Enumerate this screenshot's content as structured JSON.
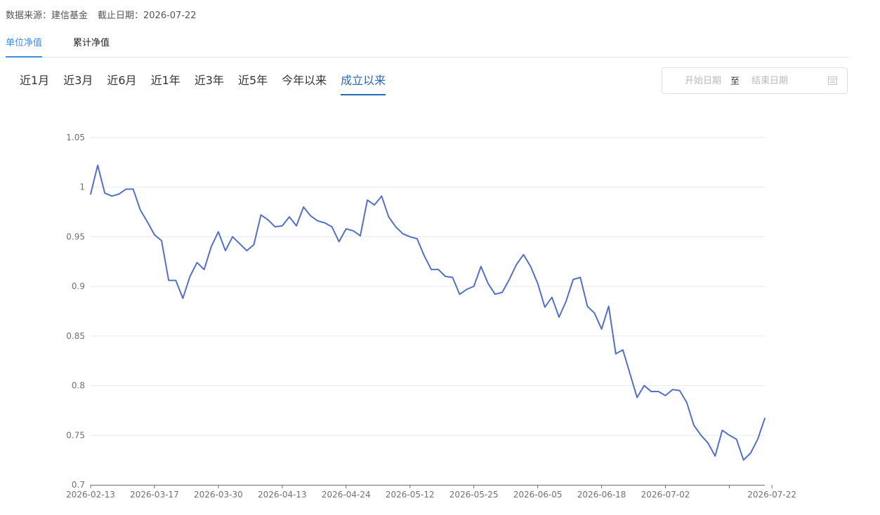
{
  "header": {
    "source_label": "数据来源：建信基金",
    "date_label": "截止日期：2026-07-22"
  },
  "tabs": [
    {
      "label": "单位净值",
      "active": true
    },
    {
      "label": "累计净值",
      "active": false
    }
  ],
  "ranges": [
    {
      "label": "近1月",
      "active": false
    },
    {
      "label": "近3月",
      "active": false
    },
    {
      "label": "近6月",
      "active": false
    },
    {
      "label": "近1年",
      "active": false
    },
    {
      "label": "近3年",
      "active": false
    },
    {
      "label": "近5年",
      "active": false
    },
    {
      "label": "今年以来",
      "active": false
    },
    {
      "label": "成立以来",
      "active": true
    }
  ],
  "date_picker": {
    "start_placeholder": "开始日期",
    "separator": "至",
    "end_placeholder": "结束日期",
    "icon": "calendar-icon"
  },
  "colors": {
    "accent_tab": "#3e8ee0",
    "accent_range": "#2868b8",
    "line": "#5470c6",
    "grid": "#e6e9ef",
    "axis": "#6e7079"
  },
  "chart_data": {
    "type": "line",
    "title": "",
    "xlabel": "",
    "ylabel": "",
    "ylim": [
      0.7,
      1.05
    ],
    "yticks": [
      "0.7",
      "0.75",
      "0.8",
      "0.85",
      "0.9",
      "0.95",
      "1",
      "1.05"
    ],
    "xtick_labels": [
      {
        "index": 0,
        "label": "2026-02-13"
      },
      {
        "index": 9,
        "label": "2026-03-17"
      },
      {
        "index": 18,
        "label": "2026-03-30"
      },
      {
        "index": 27,
        "label": "2026-04-13"
      },
      {
        "index": 36,
        "label": "2026-04-24"
      },
      {
        "index": 45,
        "label": "2026-05-12"
      },
      {
        "index": 54,
        "label": "2026-05-25"
      },
      {
        "index": 63,
        "label": "2026-06-05"
      },
      {
        "index": 72,
        "label": "2026-06-18"
      },
      {
        "index": 81,
        "label": "2026-07-02"
      },
      {
        "index": 90,
        "label": ""
      },
      {
        "index": 96,
        "label": "2026-07-22"
      }
    ],
    "grid": true,
    "series": [
      {
        "values": [
          0.993,
          1.022,
          0.994,
          0.991,
          0.993,
          0.998,
          0.998,
          0.977,
          0.965,
          0.952,
          0.946,
          0.906,
          0.906,
          0.888,
          0.91,
          0.924,
          0.917,
          0.94,
          0.955,
          0.936,
          0.95,
          0.943,
          0.936,
          0.942,
          0.972,
          0.967,
          0.96,
          0.961,
          0.97,
          0.961,
          0.98,
          0.971,
          0.966,
          0.964,
          0.96,
          0.945,
          0.958,
          0.956,
          0.951,
          0.987,
          0.982,
          0.991,
          0.97,
          0.96,
          0.953,
          0.95,
          0.948,
          0.931,
          0.917,
          0.917,
          0.91,
          0.909,
          0.892,
          0.897,
          0.9,
          0.92,
          0.903,
          0.892,
          0.894,
          0.907,
          0.922,
          0.932,
          0.92,
          0.903,
          0.879,
          0.889,
          0.869,
          0.885,
          0.907,
          0.909,
          0.88,
          0.873,
          0.857,
          0.88,
          0.832,
          0.836,
          0.812,
          0.788,
          0.8,
          0.794,
          0.794,
          0.79,
          0.796,
          0.795,
          0.783,
          0.76,
          0.75,
          0.742,
          0.729,
          0.755,
          0.75,
          0.746,
          0.725,
          0.732,
          0.746,
          0.767
        ]
      }
    ]
  }
}
